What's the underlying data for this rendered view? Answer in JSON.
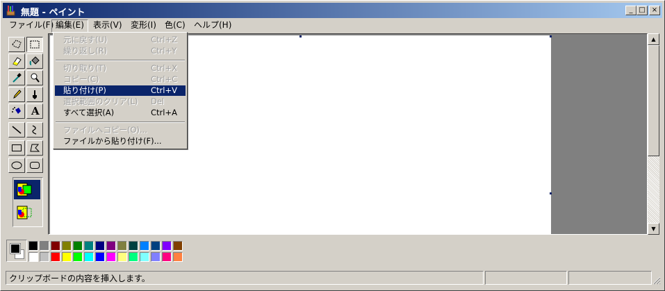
{
  "window": {
    "title": "無題 - ペイント"
  },
  "caption_buttons": {
    "minimize": "_",
    "maximize": "□",
    "close": "×"
  },
  "menubar": [
    {
      "label": "ファイル(F)"
    },
    {
      "label": "編集(E)"
    },
    {
      "label": "表示(V)"
    },
    {
      "label": "変形(I)"
    },
    {
      "label": "色(C)"
    },
    {
      "label": "ヘルプ(H)"
    }
  ],
  "edit_menu": {
    "items": [
      {
        "label": "元に戻す(U)",
        "shortcut": "Ctrl+Z"
      },
      {
        "label": "繰り返し(R)",
        "shortcut": "Ctrl+Y"
      },
      {
        "label": "切り取り(T)",
        "shortcut": "Ctrl+X"
      },
      {
        "label": "コピー(C)",
        "shortcut": "Ctrl+C"
      },
      {
        "label": "貼り付け(P)",
        "shortcut": "Ctrl+V"
      },
      {
        "label": "選択範囲のクリア(L)",
        "shortcut": "Del"
      },
      {
        "label": "すべて選択(A)",
        "shortcut": "Ctrl+A"
      },
      {
        "label": "ファイルへコピー(O)...",
        "shortcut": ""
      },
      {
        "label": "ファイルから貼り付け(F)...",
        "shortcut": ""
      }
    ]
  },
  "toolbox": {
    "tools": [
      "free-select",
      "rect-select",
      "eraser",
      "fill",
      "color-picker",
      "magnifier",
      "pencil",
      "brush",
      "airbrush",
      "text",
      "line",
      "curve",
      "rectangle",
      "polygon",
      "ellipse",
      "rounded-rectangle"
    ],
    "text_tool_glyph": "A"
  },
  "palette": {
    "foreground": "#000000",
    "background": "#ffffff",
    "top_row": [
      "#000000",
      "#808080",
      "#800000",
      "#808000",
      "#008000",
      "#008080",
      "#000080",
      "#800080",
      "#808040",
      "#004040",
      "#0080ff",
      "#004080",
      "#8000ff",
      "#804000"
    ],
    "bottom_row": [
      "#ffffff",
      "#c0c0c0",
      "#ff0000",
      "#ffff00",
      "#00ff00",
      "#00ffff",
      "#0000ff",
      "#ff00ff",
      "#ffff80",
      "#00ff80",
      "#80ffff",
      "#8080ff",
      "#ff0080",
      "#ff8040"
    ]
  },
  "statusbar": {
    "message": "クリップボードの内容を挿入します。"
  }
}
